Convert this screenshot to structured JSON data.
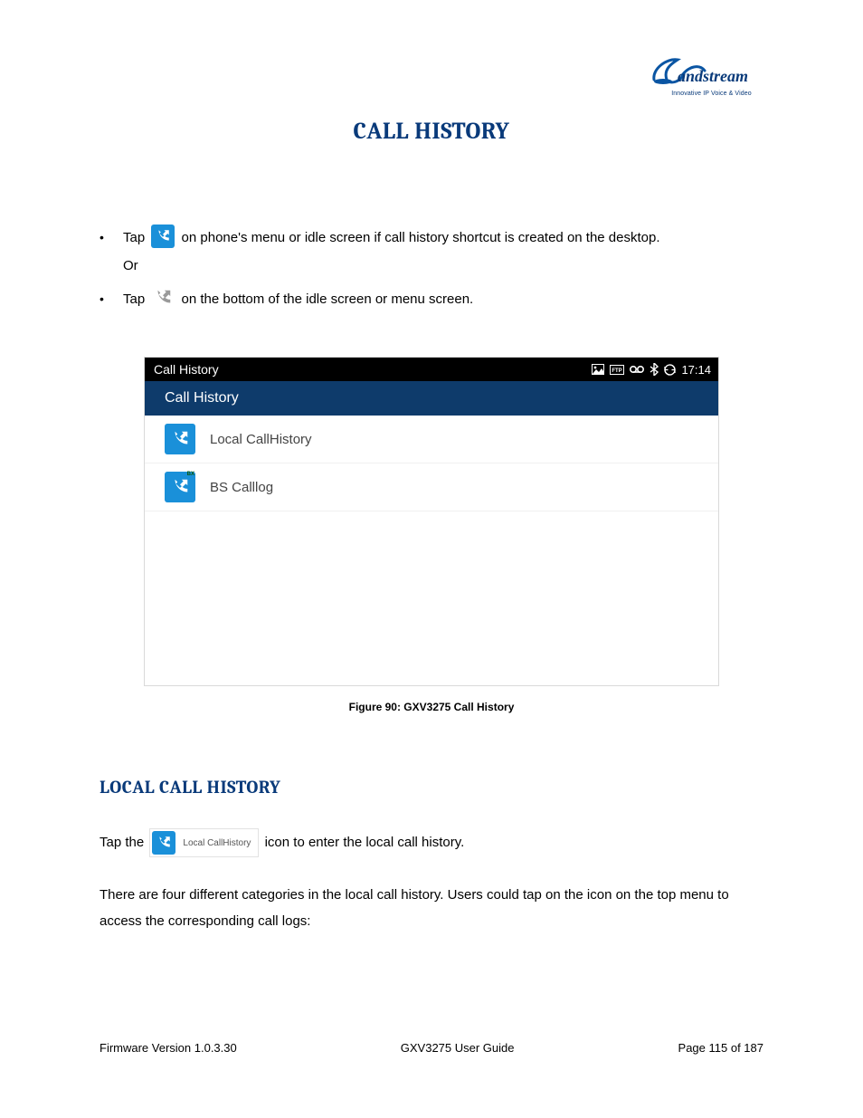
{
  "logo": {
    "brand": "Grandstream",
    "tagline": "Innovative IP Voice & Video"
  },
  "page_title": "CALL HISTORY",
  "bullets": {
    "b1_pre": "Tap",
    "b1_post": "on phone's menu or idle screen if call history shortcut is created on the desktop.",
    "or": "Or",
    "b2_pre": "Tap",
    "b2_post": "on the bottom of the idle screen or menu screen."
  },
  "screenshot": {
    "statusbar_title": "Call History",
    "statusbar_time": "17:14",
    "header": "Call History",
    "rows": [
      {
        "label": "Local CallHistory",
        "badge": ""
      },
      {
        "label": "BS Calllog",
        "badge": "BX"
      }
    ]
  },
  "figure_caption": "Figure 90: GXV3275 Call History",
  "section_heading": "LOCAL CALL HISTORY",
  "section_body": {
    "p1_pre": "Tap the",
    "mini_label": "Local CallHistory",
    "p1_post": "icon to enter the local call history.",
    "p2": "There are four different categories in the local call history. Users could tap on the icon on the top menu to access the corresponding call logs:"
  },
  "footer": {
    "left": "Firmware Version 1.0.3.30",
    "center": "GXV3275 User Guide",
    "right": "Page 115 of 187"
  }
}
